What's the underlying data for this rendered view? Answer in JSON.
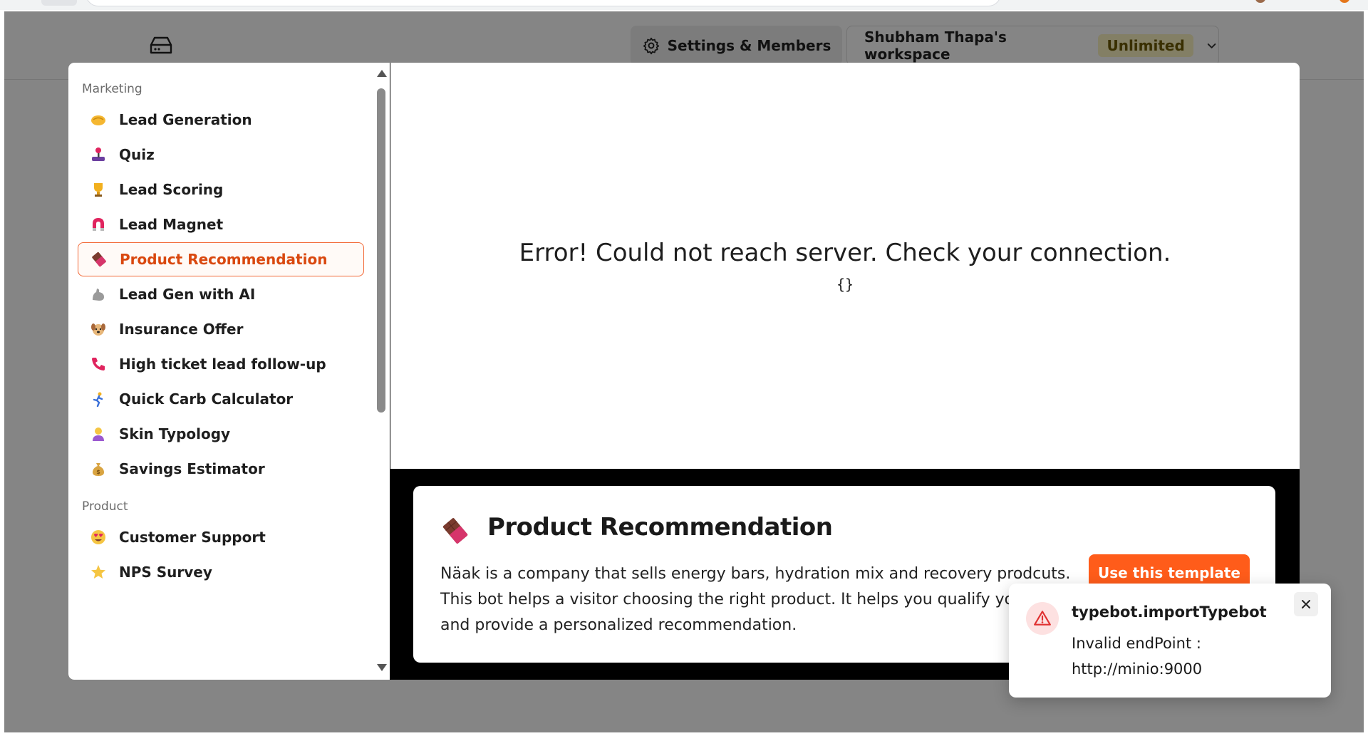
{
  "topbar": {
    "settings_label": "Settings & Members",
    "workspace_name": "Shubham Thapa's workspace",
    "plan_badge": "Unlimited"
  },
  "sidebar": {
    "sections": [
      {
        "label": "Marketing",
        "items": [
          {
            "label": "Lead Generation",
            "icon": "handshake-icon",
            "active": false
          },
          {
            "label": "Quiz",
            "icon": "joystick-icon",
            "active": false
          },
          {
            "label": "Lead Scoring",
            "icon": "trophy-icon",
            "active": false
          },
          {
            "label": "Lead Magnet",
            "icon": "magnet-icon",
            "active": false
          },
          {
            "label": "Product Recommendation",
            "icon": "chocolate-bar-icon",
            "active": true
          },
          {
            "label": "Lead Gen with AI",
            "icon": "muscle-icon",
            "active": false
          },
          {
            "label": "Insurance Offer",
            "icon": "dog-icon",
            "active": false
          },
          {
            "label": "High ticket lead follow-up",
            "icon": "phone-icon",
            "active": false
          },
          {
            "label": "Quick Carb Calculator",
            "icon": "runner-icon",
            "active": false
          },
          {
            "label": "Skin Typology",
            "icon": "person-icon",
            "active": false
          },
          {
            "label": "Savings Estimator",
            "icon": "money-bag-icon",
            "active": false
          }
        ]
      },
      {
        "label": "Product",
        "items": [
          {
            "label": "Customer Support",
            "icon": "heart-eyes-icon",
            "active": false
          },
          {
            "label": "NPS Survey",
            "icon": "star-icon",
            "active": false
          }
        ]
      }
    ]
  },
  "preview": {
    "error": "Error! Could not reach server. Check your connection.",
    "json": "{}"
  },
  "template": {
    "title": "Product Recommendation",
    "description": "Näak is a company that sells energy bars, hydration mix and recovery prodcuts. This bot helps a visitor choosing the right product. It helps you qualify your lead and provide a personalized recommendation.",
    "use_button": "Use this template"
  },
  "toast": {
    "title": "typebot.importTypebot",
    "message": "Invalid endPoint : http://minio:9000"
  },
  "colors": {
    "accent": "#ff5c1a",
    "active_border": "#f26a38",
    "active_text": "#d9480f",
    "plan_badge_bg": "#fbf3c2",
    "error_icon_bg": "#fde1e1"
  }
}
